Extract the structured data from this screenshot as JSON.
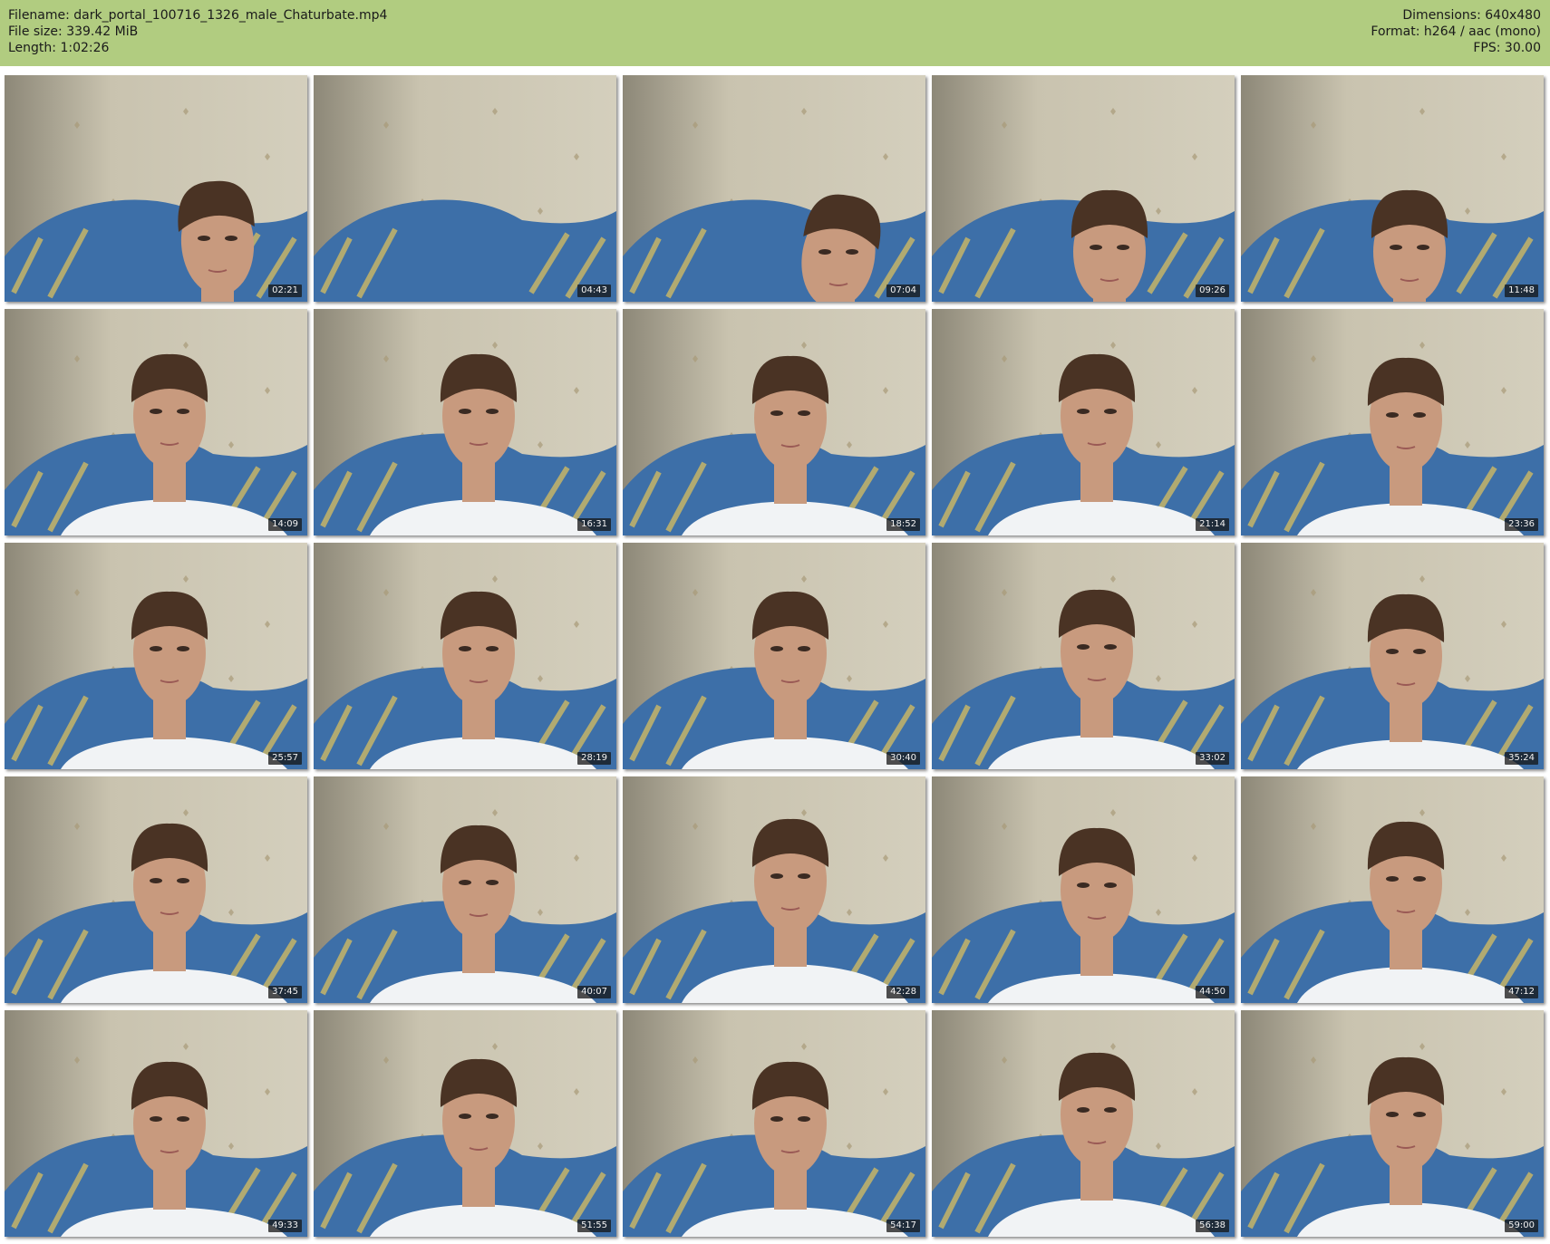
{
  "header": {
    "filename": "Filename: dark_portal_100716_1326_male_Chaturbate.mp4",
    "filesize": "File size: 339.42 MiB",
    "length": "Length: 1:02:26",
    "dimensions": "Dimensions: 640x480",
    "format": "Format: h264 / aac (mono)",
    "fps": "FPS: 30.00"
  },
  "colors": {
    "header_bg": "#b1cc80",
    "wall": "#c9c3af",
    "shirt": "#f1f3f5",
    "blanket": "#3d6fa8",
    "hair": "#4a3324",
    "skin": "#c89a7e"
  },
  "thumbnails": [
    {
      "timestamp": "02:21"
    },
    {
      "timestamp": "04:43"
    },
    {
      "timestamp": "07:04"
    },
    {
      "timestamp": "09:26"
    },
    {
      "timestamp": "11:48"
    },
    {
      "timestamp": "14:09"
    },
    {
      "timestamp": "16:31"
    },
    {
      "timestamp": "18:52"
    },
    {
      "timestamp": "21:14"
    },
    {
      "timestamp": "23:36"
    },
    {
      "timestamp": "25:57"
    },
    {
      "timestamp": "28:19"
    },
    {
      "timestamp": "30:40"
    },
    {
      "timestamp": "33:02"
    },
    {
      "timestamp": "35:24"
    },
    {
      "timestamp": "37:45"
    },
    {
      "timestamp": "40:07"
    },
    {
      "timestamp": "42:28"
    },
    {
      "timestamp": "44:50"
    },
    {
      "timestamp": "47:12"
    },
    {
      "timestamp": "49:33"
    },
    {
      "timestamp": "51:55"
    },
    {
      "timestamp": "54:17"
    },
    {
      "timestamp": "56:38"
    },
    {
      "timestamp": "59:00"
    }
  ]
}
